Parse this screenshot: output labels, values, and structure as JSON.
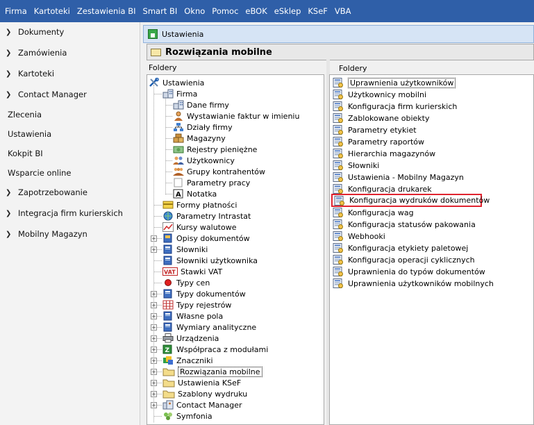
{
  "menu": [
    "Firma",
    "Kartoteki",
    "Zestawienia BI",
    "Smart BI",
    "Okno",
    "Pomoc",
    "eBOK",
    "eSklep",
    "KSeF",
    "VBA"
  ],
  "sidebar": {
    "items": [
      {
        "label": "Dokumenty",
        "chevron": true
      },
      {
        "label": "Zamówienia",
        "chevron": true
      },
      {
        "label": "Kartoteki",
        "chevron": true
      },
      {
        "label": "Contact Manager",
        "chevron": true
      },
      {
        "label": "Zlecenia",
        "chevron": false
      },
      {
        "label": "Ustawienia",
        "chevron": false
      },
      {
        "label": "Kokpit BI",
        "chevron": false
      },
      {
        "label": "Wsparcie online",
        "chevron": false
      },
      {
        "label": "Zapotrzebowanie",
        "chevron": true
      },
      {
        "label": "Integracja firm kurierskich",
        "chevron": true
      },
      {
        "label": "Mobilny Magazyn",
        "chevron": true
      }
    ]
  },
  "window": {
    "title": "Ustawienia",
    "header": "Rozwiązania mobilne",
    "left_header": "Foldery",
    "right_header": "Foldery"
  },
  "tree": [
    {
      "label": "Ustawienia",
      "icon": "tools-icon"
    },
    {
      "label": "Firma",
      "icon": "company-icon"
    },
    {
      "label": "Dane firmy",
      "icon": "company-icon"
    },
    {
      "label": "Wystawianie faktur w imieniu",
      "icon": "person-icon"
    },
    {
      "label": "Działy firmy",
      "icon": "org-icon"
    },
    {
      "label": "Magazyny",
      "icon": "boxes-icon"
    },
    {
      "label": "Rejestry pieniężne",
      "icon": "money-icon"
    },
    {
      "label": "Użytkownicy",
      "icon": "users-icon"
    },
    {
      "label": "Grupy kontrahentów",
      "icon": "groups-icon"
    },
    {
      "label": "Parametry pracy",
      "icon": "blank-icon"
    },
    {
      "label": "Notatka",
      "icon": "note-icon"
    },
    {
      "label": "Formy płatności",
      "icon": "payment-icon"
    },
    {
      "label": "Parametry Intrastat",
      "icon": "intrastat-icon"
    },
    {
      "label": "Kursy walutowe",
      "icon": "chart-icon"
    },
    {
      "label": "Opisy dokumentów",
      "icon": "doc-desc-icon"
    },
    {
      "label": "Słowniki",
      "icon": "book-icon"
    },
    {
      "label": "Słowniki użytkownika",
      "icon": "book-icon"
    },
    {
      "label": "Stawki VAT",
      "icon": "vat-icon"
    },
    {
      "label": "Typy cen",
      "icon": "red-dot-icon"
    },
    {
      "label": "Typy dokumentów",
      "icon": "book-icon"
    },
    {
      "label": "Typy rejestrów",
      "icon": "grid-icon"
    },
    {
      "label": "Własne pola",
      "icon": "book-icon"
    },
    {
      "label": "Wymiary analityczne",
      "icon": "book-icon"
    },
    {
      "label": "Urządzenia",
      "icon": "printer-icon"
    },
    {
      "label": "Współpraca z modułami",
      "icon": "modules-icon"
    },
    {
      "label": "Znaczniki",
      "icon": "tags-icon"
    },
    {
      "label": "Rozwiązania mobilne",
      "icon": "folder-icon"
    },
    {
      "label": "Ustawienia KSeF",
      "icon": "folder-icon"
    },
    {
      "label": "Szablony wydruku",
      "icon": "folder-icon"
    },
    {
      "label": "Contact Manager",
      "icon": "contact-icon"
    },
    {
      "label": "Symfonia",
      "icon": "symfonia-icon"
    }
  ],
  "right_items": [
    "Uprawnienia użytkowników",
    "Użytkownicy mobilni",
    "Konfiguracja firm kurierskich",
    "Zablokowane obiekty",
    "Parametry etykiet",
    "Parametry raportów",
    "Hierarchia magazynów",
    "Słowniki",
    "Ustawienia - Mobilny Magazyn",
    "Konfiguracja drukarek",
    "Konfiguracja wydruków dokumentów",
    "Konfiguracja wag",
    "Konfiguracja statusów pakowania",
    "Webhooki",
    "Konfiguracja etykiety paletowej",
    "Konfiguracja operacji cyklicznych",
    "Uprawnienia do typów dokumentów",
    "Uprawnienia użytkowników mobilnych"
  ],
  "colors": {
    "menubar": "#2f5fa8",
    "highlight": "#e0232f"
  }
}
